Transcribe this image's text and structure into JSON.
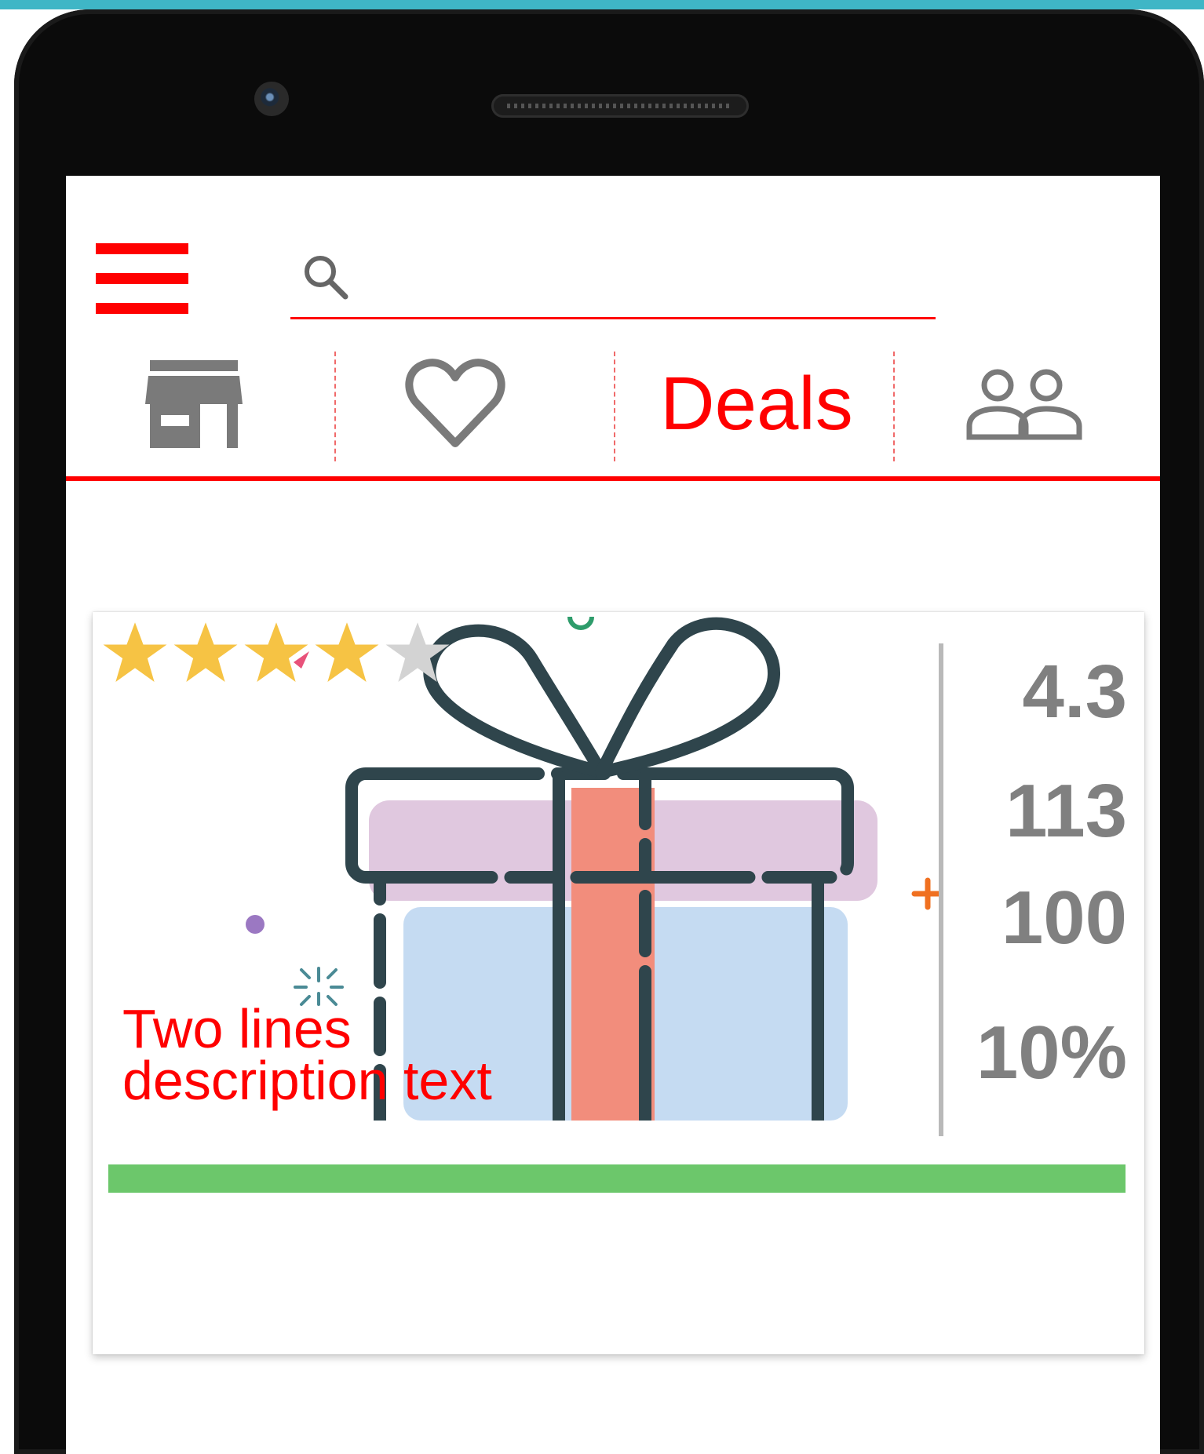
{
  "search": {
    "value": "",
    "placeholder": ""
  },
  "tabs": [
    {
      "id": "store",
      "icon": "store-icon"
    },
    {
      "id": "favorites",
      "icon": "heart-icon"
    },
    {
      "id": "deals",
      "label": "Deals"
    },
    {
      "id": "people",
      "icon": "people-icon"
    }
  ],
  "card": {
    "rating_stars": {
      "filled": 4,
      "total": 5
    },
    "description": "Two lines\ndescription text",
    "stats": [
      "4.3",
      "113",
      "100",
      "10%"
    ],
    "progress_percent": 100
  },
  "colors": {
    "accent": "#ff0000",
    "icon_gray": "#7a7a7a",
    "star_gold": "#f6c344",
    "star_gray": "#d3d3d3",
    "progress_green": "#6cc76b",
    "top_strip": "#3fb6c6"
  }
}
